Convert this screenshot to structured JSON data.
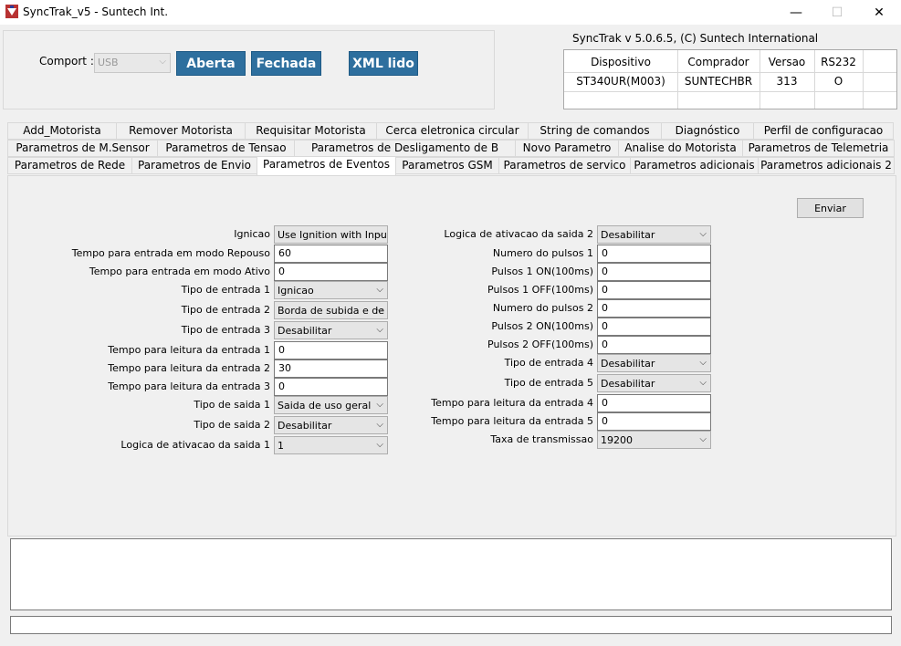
{
  "window": {
    "title": "SyncTrak_v5 - Suntech Int.",
    "minimize_glyph": "—",
    "maximize_glyph": "☐",
    "close_glyph": "✕"
  },
  "connection": {
    "comport_label": "Comport :",
    "comport_value": "USB",
    "open_label": "Aberta",
    "close_label": "Fechada",
    "xml_label": "XML lido"
  },
  "app_info": "SyncTrak v 5.0.6.5, (C) Suntech International",
  "device_table": {
    "headers": [
      "Dispositivo",
      "Comprador",
      "Versao",
      "RS232"
    ],
    "row": [
      "ST340UR(M003)",
      "SUNTECHBR",
      "313",
      "O"
    ]
  },
  "tabs": {
    "row1": [
      "Add_Motorista",
      "Remover Motorista",
      "Requisitar Motorista",
      "Cerca eletronica circular",
      "String de comandos",
      "Diagnóstico",
      "Perfil de configuracao"
    ],
    "row2": [
      "Parametros  de M.Sensor",
      "Parametros de Tensao",
      "Parametros de Desligamento de B",
      "Novo Parametro",
      "Analise do Motorista",
      "Parametros de Telemetria"
    ],
    "row3": [
      "Parametros de Rede",
      "Parametros de Envio",
      "Parametros de Eventos",
      "Parametros GSM",
      "Parametros de servico",
      "Parametros adicionais",
      "Parametros adicionais 2"
    ],
    "active": "Parametros de Eventos"
  },
  "send_label": "Enviar",
  "left_fields": [
    {
      "label": "Ignicao",
      "type": "combo",
      "value": "Use Ignition with Inpu"
    },
    {
      "label": "Tempo para entrada em modo Repouso",
      "type": "text",
      "value": "60"
    },
    {
      "label": "Tempo para entrada em modo Ativo",
      "type": "text",
      "value": "0"
    },
    {
      "label": "Tipo de entrada 1",
      "type": "combo",
      "value": "Ignicao"
    },
    {
      "label": "Tipo de entrada 2",
      "type": "combo",
      "value": "Borda de subida e de"
    },
    {
      "label": "Tipo de entrada 3",
      "type": "combo",
      "value": "Desabilitar"
    },
    {
      "label": "Tempo para leitura da entrada 1",
      "type": "text",
      "value": "0"
    },
    {
      "label": "Tempo para leitura da entrada 2",
      "type": "text",
      "value": "30"
    },
    {
      "label": "Tempo para leitura da entrada 3",
      "type": "text",
      "value": "0"
    },
    {
      "label": "Tipo de saida 1",
      "type": "combo",
      "value": "Saida de uso geral"
    },
    {
      "label": "Tipo de saida 2",
      "type": "combo",
      "value": "Desabilitar"
    },
    {
      "label": "Logica de ativacao da saida 1",
      "type": "combo",
      "value": "1"
    }
  ],
  "right_fields": [
    {
      "label": "Logica de ativacao da saida 2",
      "type": "combo",
      "value": "Desabilitar"
    },
    {
      "label": "Numero do pulsos 1",
      "type": "text",
      "value": "0"
    },
    {
      "label": "Pulsos 1 ON(100ms)",
      "type": "text",
      "value": "0"
    },
    {
      "label": "Pulsos 1 OFF(100ms)",
      "type": "text",
      "value": "0"
    },
    {
      "label": "Numero do pulsos 2",
      "type": "text",
      "value": "0"
    },
    {
      "label": "Pulsos 2 ON(100ms)",
      "type": "text",
      "value": "0"
    },
    {
      "label": "Pulsos 2 OFF(100ms)",
      "type": "text",
      "value": "0"
    },
    {
      "label": "Tipo de entrada 4",
      "type": "combo",
      "value": "Desabilitar"
    },
    {
      "label": "Tipo de entrada 5",
      "type": "combo",
      "value": "Desabilitar"
    },
    {
      "label": "Tempo para leitura da entrada 4",
      "type": "text",
      "value": "0"
    },
    {
      "label": "Tempo para leitura da entrada 5",
      "type": "text",
      "value": "0"
    },
    {
      "label": "Taxa de transmissao",
      "type": "combo",
      "value": "19200"
    }
  ],
  "colors": {
    "accent_button": "#2e6f9e"
  }
}
